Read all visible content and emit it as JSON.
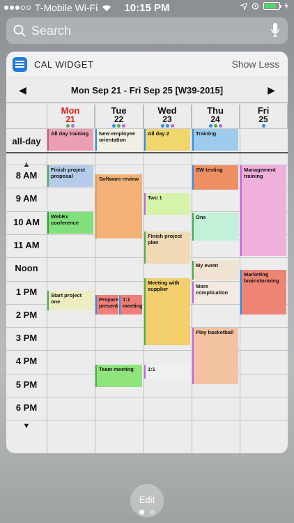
{
  "status_bar": {
    "carrier": "T-Mobile Wi-Fi",
    "time": "10:15 PM"
  },
  "search": {
    "placeholder": "Search"
  },
  "widget": {
    "title": "CAL WIDGET",
    "toggle_label": "Show Less",
    "date_range": "Mon Sep 21 - Fri Sep 25 [W39-2015]"
  },
  "days": [
    {
      "name": "Mon",
      "date": "21",
      "today": true,
      "dots": [
        "#4caf50",
        "#c066e0"
      ]
    },
    {
      "name": "Tue",
      "date": "22",
      "today": false,
      "dots": [
        "#2f8fe8",
        "#4caf50",
        "#c066e0"
      ]
    },
    {
      "name": "Wed",
      "date": "23",
      "today": false,
      "dots": [
        "#2f8fe8",
        "#2f8fe8",
        "#c066e0"
      ]
    },
    {
      "name": "Thu",
      "date": "24",
      "today": false,
      "dots": [
        "#2f8fe8",
        "#4caf50",
        "#c066e0"
      ]
    },
    {
      "name": "Fri",
      "date": "25",
      "today": false,
      "dots": [
        "#2f8fe8"
      ]
    }
  ],
  "allday_label": "all-day",
  "hours": [
    "8 AM",
    "9 AM",
    "10 AM",
    "11 AM",
    "Noon",
    "1 PM",
    "2 PM",
    "3 PM",
    "4 PM",
    "5 PM",
    "6 PM"
  ],
  "allday_events": [
    {
      "day": 0,
      "title": "All day training",
      "color": "#eaa0b2",
      "bar": "#d25b7c"
    },
    {
      "day": 1,
      "title": "New employee orientation",
      "color": "#f2f0e4",
      "bar": "#2f8fe8"
    },
    {
      "day": 2,
      "title": "All day 2",
      "color": "#f0d66c",
      "bar": "#2f8fe8"
    },
    {
      "day": 3,
      "title": "Training",
      "color": "#9ccbee",
      "bar": "#2f8fe8"
    }
  ],
  "events": [
    {
      "day": 0,
      "start": 8.0,
      "end": 9.0,
      "title": "Finish project proposal",
      "color": "#b4ccea",
      "bar": "#4caf50"
    },
    {
      "day": 0,
      "start": 10.0,
      "end": 11.0,
      "title": "WebEx conference",
      "color": "#7fe07c",
      "bar": "#2fa43a"
    },
    {
      "day": 0,
      "start": 13.4,
      "end": 14.3,
      "title": "Start project one",
      "color": "#eeedc2",
      "bar": "#4caf50"
    },
    {
      "day": 1,
      "start": 8.4,
      "end": 11.2,
      "title": "Software review",
      "color": "#f2b277",
      "bar": "#e0a155"
    },
    {
      "day": 1,
      "start": 13.6,
      "end": 14.5,
      "title": "Prepare presentation",
      "color": "#ef7f78",
      "bar": "#2f8fe8",
      "half": 0
    },
    {
      "day": 1,
      "start": 13.6,
      "end": 14.5,
      "title": "1:1 meeting",
      "color": "#ef7f78",
      "bar": "#2f8fe8",
      "half": 1
    },
    {
      "day": 1,
      "start": 16.6,
      "end": 17.6,
      "title": "Team meeting",
      "color": "#8fe47b",
      "bar": "#4caf50"
    },
    {
      "day": 2,
      "start": 9.2,
      "end": 10.2,
      "title": "Two 1",
      "color": "#d6f4a9",
      "bar": "#c066e0"
    },
    {
      "day": 2,
      "start": 10.85,
      "end": 12.3,
      "title": "Finish project plan",
      "color": "#f2d9b6",
      "bar": "#4caf50"
    },
    {
      "day": 2,
      "start": 12.85,
      "end": 15.8,
      "title": "Meeting with supplier",
      "color": "#f2ce6d",
      "bar": "#4caf50"
    },
    {
      "day": 2,
      "start": 16.6,
      "end": 17.25,
      "title": "1:1",
      "color": "#eef1ee",
      "bar": "#c066e0"
    },
    {
      "day": 3,
      "start": 8.0,
      "end": 9.1,
      "title": "SW testing",
      "color": "#ef9064",
      "bar": "#2f8fe8"
    },
    {
      "day": 3,
      "start": 10.05,
      "end": 11.3,
      "title": "One",
      "color": "#c2f1d9",
      "bar": "#4caf50"
    },
    {
      "day": 3,
      "start": 12.1,
      "end": 13.0,
      "title": "My event",
      "color": "#f2e2d2",
      "bar": "#4caf50"
    },
    {
      "day": 3,
      "start": 13.0,
      "end": 14.0,
      "title": "More complication",
      "color": "#f3ebe3",
      "bar": "#c066e0"
    },
    {
      "day": 3,
      "start": 15.0,
      "end": 17.5,
      "title": "Play basketball",
      "color": "#f3c3a1",
      "bar": "#c066e0"
    },
    {
      "day": 4,
      "start": 8.0,
      "end": 11.95,
      "title": "Management training",
      "color": "#f0b0dc",
      "bar": "#c066e0"
    },
    {
      "day": 4,
      "start": 12.5,
      "end": 14.5,
      "title": "Marketing brainstorming",
      "color": "#ee8474",
      "bar": "#2f8fe8"
    }
  ],
  "bottom": {
    "edit_label": "Edit"
  }
}
